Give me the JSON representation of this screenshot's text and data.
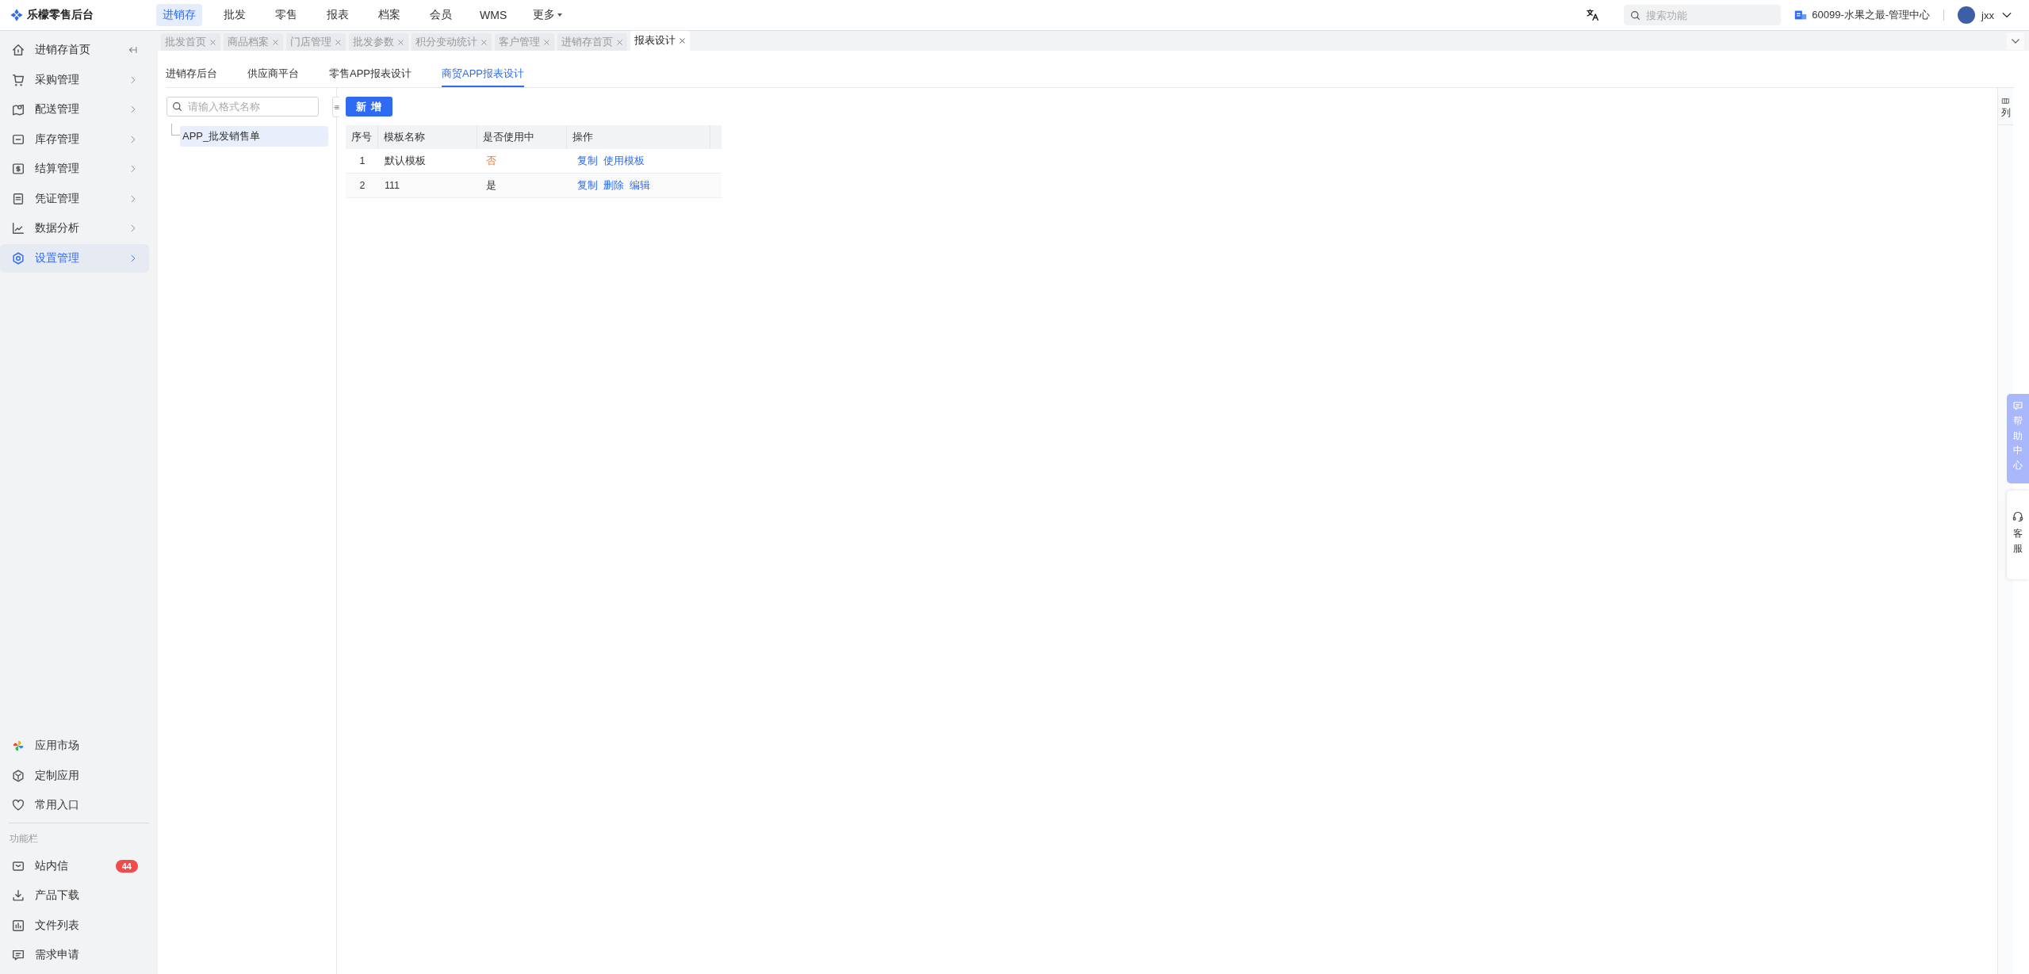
{
  "brand": {
    "title": "乐檬零售后台"
  },
  "top_nav": [
    {
      "label": "进销存",
      "selected": true
    },
    {
      "label": "批发",
      "selected": false
    },
    {
      "label": "零售",
      "selected": false
    },
    {
      "label": "报表",
      "selected": false
    },
    {
      "label": "档案",
      "selected": false
    },
    {
      "label": "会员",
      "selected": false
    },
    {
      "label": "WMS",
      "selected": false
    },
    {
      "label": "更多",
      "selected": false,
      "kind": "dropdown"
    }
  ],
  "search": {
    "placeholder": "搜索功能"
  },
  "org": {
    "name": "60099-水果之最-管理中心"
  },
  "user": {
    "name": "jxx"
  },
  "tabs": [
    {
      "label": "批发首页",
      "selected": false
    },
    {
      "label": "商品档案",
      "selected": false
    },
    {
      "label": "门店管理",
      "selected": false
    },
    {
      "label": "批发参数",
      "selected": false
    },
    {
      "label": "积分变动统计",
      "selected": false
    },
    {
      "label": "客户管理",
      "selected": false
    },
    {
      "label": "进销存首页",
      "selected": false
    },
    {
      "label": "报表设计",
      "selected": true
    }
  ],
  "sidebar": {
    "items": [
      {
        "label": "进销存首页",
        "kind": "home",
        "selected": false
      },
      {
        "label": "采购管理",
        "kind": "group",
        "selected": false
      },
      {
        "label": "配送管理",
        "kind": "group",
        "selected": false
      },
      {
        "label": "库存管理",
        "kind": "group",
        "selected": false
      },
      {
        "label": "结算管理",
        "kind": "group",
        "selected": false
      },
      {
        "label": "凭证管理",
        "kind": "group",
        "selected": false
      },
      {
        "label": "数据分析",
        "kind": "group",
        "selected": false
      },
      {
        "label": "设置管理",
        "kind": "group",
        "selected": true
      }
    ],
    "apps": [
      {
        "label": "应用市场"
      },
      {
        "label": "定制应用"
      },
      {
        "label": "常用入口"
      }
    ],
    "section_title": "功能栏",
    "tools": [
      {
        "label": "站内信",
        "badge": "44"
      },
      {
        "label": "产品下载"
      },
      {
        "label": "文件列表"
      },
      {
        "label": "需求申请"
      }
    ]
  },
  "sub_tabs": [
    {
      "label": "进销存后台",
      "selected": false
    },
    {
      "label": "供应商平台",
      "selected": false
    },
    {
      "label": "零售APP报表设计",
      "selected": false
    },
    {
      "label": "商贸APP报表设计",
      "selected": true
    }
  ],
  "tree": {
    "search_placeholder": "请输入格式名称",
    "nodes": [
      {
        "label": "APP_批发销售单",
        "selected": true
      }
    ]
  },
  "add_button": "新 增",
  "table": {
    "columns": [
      "序号",
      "模板名称",
      "是否使用中",
      "操作"
    ],
    "rows": [
      {
        "index": "1",
        "name": "默认模板",
        "in_use": false,
        "in_use_text": "否",
        "actions": [
          "复制",
          "使用模板"
        ]
      },
      {
        "index": "2",
        "name": "111",
        "in_use": true,
        "in_use_text": "是",
        "actions": [
          "复制",
          "删除",
          "编辑"
        ]
      }
    ]
  },
  "column_settings": {
    "label": "列"
  },
  "float_help": {
    "label": "帮助中心"
  },
  "float_service": {
    "label": "客服"
  }
}
